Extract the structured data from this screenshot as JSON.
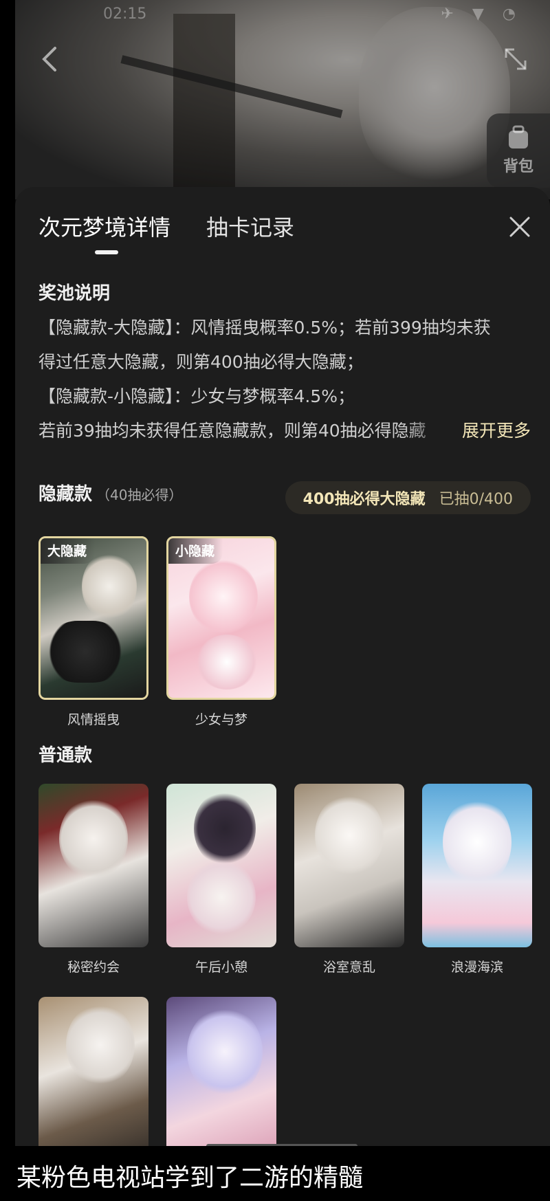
{
  "status": {
    "time": "02:15",
    "icons": "✈ ▼ ◔"
  },
  "hero": {
    "backpack_label": "背包"
  },
  "tabs": [
    {
      "label": "次元梦境详情",
      "active": true
    },
    {
      "label": "抽卡记录",
      "active": false
    }
  ],
  "pool": {
    "title": "奖池说明",
    "lines": [
      "【隐藏款-大隐藏】：风情摇曳概率0.5%；若前399抽均未获",
      "得过任意大隐藏，则第400抽必得大隐藏；",
      "【隐藏款-小隐藏】：少女与梦概率4.5%；",
      "若前39抽均未获得任意隐藏款，则第40抽必得隐藏"
    ],
    "expand_label": "展开更多"
  },
  "hidden": {
    "title": "隐藏款",
    "subtitle": "（40抽必得）",
    "guarantee_label": "400抽必得大隐藏",
    "progress_label": "已抽0/400",
    "cards": [
      {
        "tag": "大隐藏",
        "label": "风情摇曳"
      },
      {
        "tag": "小隐藏",
        "label": "少女与梦"
      }
    ]
  },
  "normal": {
    "title": "普通款",
    "cards": [
      {
        "label": "秘密约会"
      },
      {
        "label": "午后小憩"
      },
      {
        "label": "浴室意乱"
      },
      {
        "label": "浪漫海滨"
      },
      {
        "label": ""
      },
      {
        "label": ""
      }
    ]
  },
  "caption": "某粉色电视站学到了二游的精髓",
  "colors": {
    "accent_gold": "#f3e6b8",
    "sheet_bg": "#1d1d1d",
    "rare_border": "#e3d6a0"
  }
}
